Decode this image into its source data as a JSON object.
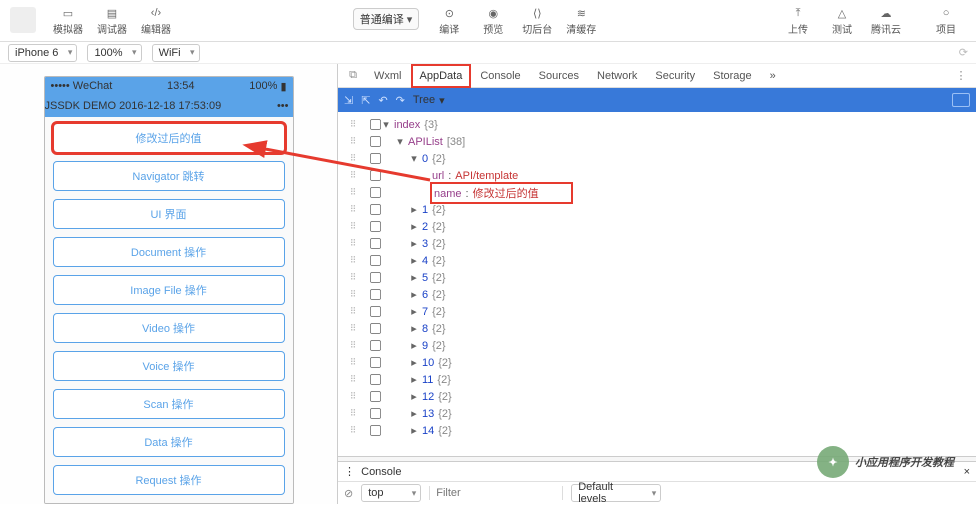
{
  "toolbar": {
    "simulator": "模拟器",
    "debugger": "调试器",
    "editor": "编辑器",
    "compile_mode": "普通编译",
    "compile": "编译",
    "preview": "预览",
    "background": "切后台",
    "clear_cache": "清缓存",
    "upload": "上传",
    "test": "测试",
    "tencent_cloud": "腾讯云",
    "project": "项目"
  },
  "subbar": {
    "device": "iPhone 6",
    "zoom": "100%",
    "network": "WiFi"
  },
  "phone": {
    "carrier": "WeChat",
    "time": "13:54",
    "battery": "100%",
    "title": "JSSDK DEMO 2016-12-18 17:53:09",
    "buttons": [
      "修改过后的值",
      "Navigator 跳转",
      "UI 界面",
      "Document 操作",
      "Image File 操作",
      "Video 操作",
      "Voice 操作",
      "Scan 操作",
      "Data 操作",
      "Request 操作"
    ]
  },
  "devtools": {
    "tabs": [
      "Wxml",
      "AppData",
      "Console",
      "Sources",
      "Network",
      "Security",
      "Storage"
    ],
    "active_tab": "AppData",
    "more": "»",
    "tree_label": "Tree",
    "console_label": "Console",
    "context": "top",
    "filter_placeholder": "Filter",
    "levels": "Default levels"
  },
  "tree": {
    "root": {
      "key": "index",
      "suffix": "{3}"
    },
    "apilist": {
      "key": "APIList",
      "suffix": "[38]"
    },
    "item0": {
      "idx": "0",
      "suffix": "{2}",
      "url_key": "url",
      "url_val": "API/template",
      "name_key": "name",
      "name_val": "修改过后的值"
    },
    "rest": [
      {
        "idx": "1",
        "suffix": "{2}"
      },
      {
        "idx": "2",
        "suffix": "{2}"
      },
      {
        "idx": "3",
        "suffix": "{2}"
      },
      {
        "idx": "4",
        "suffix": "{2}"
      },
      {
        "idx": "5",
        "suffix": "{2}"
      },
      {
        "idx": "6",
        "suffix": "{2}"
      },
      {
        "idx": "7",
        "suffix": "{2}"
      },
      {
        "idx": "8",
        "suffix": "{2}"
      },
      {
        "idx": "9",
        "suffix": "{2}"
      },
      {
        "idx": "10",
        "suffix": "{2}"
      },
      {
        "idx": "11",
        "suffix": "{2}"
      },
      {
        "idx": "12",
        "suffix": "{2}"
      },
      {
        "idx": "13",
        "suffix": "{2}"
      },
      {
        "idx": "14",
        "suffix": "{2}"
      }
    ]
  },
  "watermark": "小应用程序开发教程"
}
